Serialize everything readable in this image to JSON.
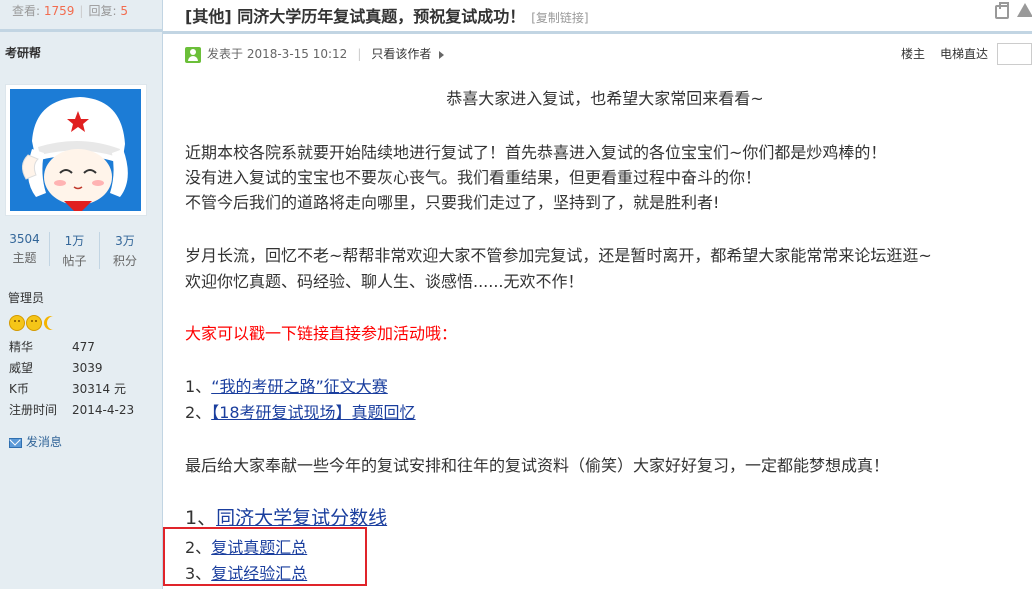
{
  "stats": {
    "views_label": "查看:",
    "views": "1759",
    "replies_label": "回复:",
    "replies": "5"
  },
  "user": {
    "name": "考研帮",
    "counts": [
      {
        "value": "3504",
        "label": "主题"
      },
      {
        "value": "1万",
        "label": "帖子"
      },
      {
        "value": "3万",
        "label": "积分"
      }
    ],
    "role": "管理员",
    "profile": [
      {
        "key": "精华",
        "value": "477"
      },
      {
        "key": "威望",
        "value": "3039"
      },
      {
        "key": "K币",
        "value": "30314 元"
      },
      {
        "key": "注册时间",
        "value": "2014-4-23"
      }
    ],
    "send_message": "发消息"
  },
  "thread": {
    "title": "[其他] 同济大学历年复试真题，预祝复试成功！",
    "copy_link": "[复制链接]",
    "posted": "发表于 2018-3-15 10:12",
    "author_only": "只看该作者",
    "floor": "楼主",
    "elevator": "电梯直达"
  },
  "post": {
    "greeting": "恭喜大家进入复试，也希望大家常回来看看~",
    "para1": [
      "近期本校各院系就要开始陆续地进行复试了！首先恭喜进入复试的各位宝宝们~你们都是炒鸡棒的！",
      "没有进入复试的宝宝也不要灰心丧气。我们看重结果，但更看重过程中奋斗的你！",
      "不管今后我们的道路将走向哪里，只要我们走过了，坚持到了，就是胜利者!"
    ],
    "para2": [
      "岁月长流，回忆不老~帮帮非常欢迎大家不管参加完复试，还是暂时离开，都希望大家能常常来论坛逛逛~",
      "欢迎你忆真题、码经验、聊人生、谈感悟......无欢不作！"
    ],
    "activity_prompt": "大家可以戳一下链接直接参加活动哦：",
    "activities": [
      {
        "num": "1、",
        "text": "“我的考研之路”征文大赛"
      },
      {
        "num": "2、",
        "text": "【18考研复试现场】真题回忆"
      }
    ],
    "closing": "最后给大家奉献一些今年的复试安排和往年的复试资料（偷笑）大家好好复习，一定都能梦想成真！",
    "resources": [
      {
        "num": "1、",
        "text": "同济大学复试分数线"
      },
      {
        "num": "2、",
        "text": "复试真题汇总"
      },
      {
        "num": "3、",
        "text": "复试经验汇总"
      }
    ]
  },
  "colors": {
    "sidebar_bg": "#e5edf2",
    "link": "#1a3e9e",
    "highlight_box": "#e0242a",
    "prompt_red": "#ff0000"
  }
}
